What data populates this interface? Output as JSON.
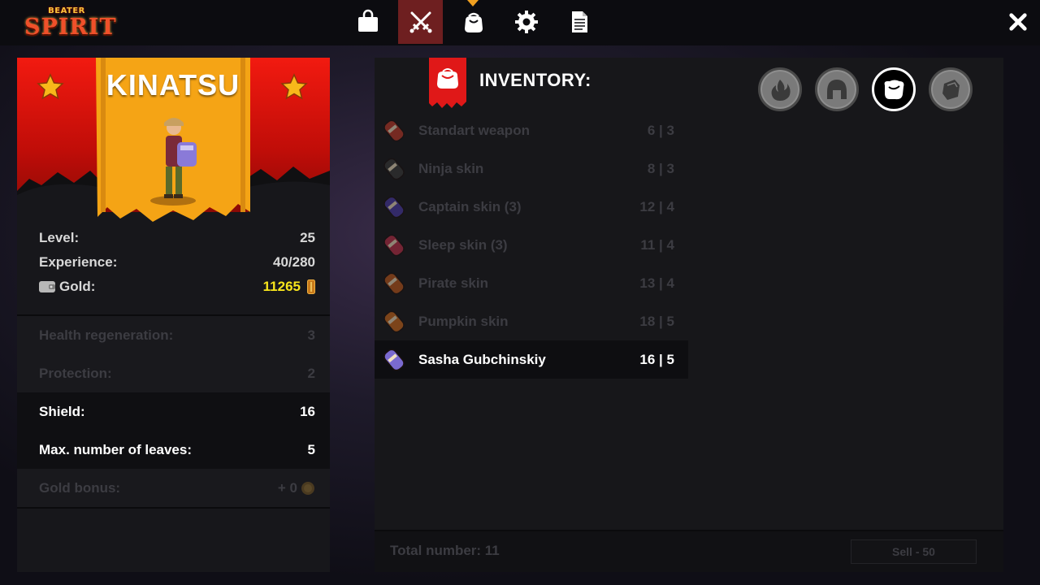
{
  "logo": {
    "top_text": "BEATER",
    "main_text": "SPIRIT"
  },
  "nav": {
    "items": [
      {
        "name": "shop",
        "icon": "shopping-bag-icon",
        "active": false
      },
      {
        "name": "equipment",
        "icon": "crossed-swords-icon",
        "active": true
      },
      {
        "name": "inventory",
        "icon": "bag-icon",
        "active": false,
        "has_marker": true
      },
      {
        "name": "settings",
        "icon": "gear-icon",
        "active": false
      },
      {
        "name": "notes",
        "icon": "document-icon",
        "active": false
      }
    ],
    "close_icon": "close-icon"
  },
  "character": {
    "name": "KINATSU",
    "stats": {
      "level_label": "Level:",
      "level_value": "25",
      "experience_label": "Experience:",
      "experience_value": "40/280",
      "gold_label": "Gold:",
      "gold_value": "11265"
    },
    "attributes": [
      {
        "label": "Health regeneration:",
        "value": "3",
        "active": false
      },
      {
        "label": "Protection:",
        "value": "2",
        "active": false
      },
      {
        "label": "Shield:",
        "value": "16",
        "active": true
      },
      {
        "label": "Max. number of leaves:",
        "value": "5",
        "active": true
      },
      {
        "label": "Gold bonus:",
        "value": "+ 0",
        "active": false
      }
    ]
  },
  "inventory": {
    "title": "INVENTORY:",
    "filters": [
      {
        "icon": "fire-icon",
        "active": false
      },
      {
        "icon": "helmet-icon",
        "active": false
      },
      {
        "icon": "bag-icon",
        "active": true
      },
      {
        "icon": "stone-icon",
        "active": false
      }
    ],
    "items": [
      {
        "name": "Standart weapon",
        "stats": "6 | 3",
        "color": "#c23a2a",
        "selected": false
      },
      {
        "name": "Ninja skin",
        "stats": "8 | 3",
        "color": "#3a3a3a",
        "selected": false
      },
      {
        "name": "Captain skin (3)",
        "stats": "12 | 4",
        "color": "#4b3aa8",
        "selected": false
      },
      {
        "name": "Sleep skin (3)",
        "stats": "11 | 4",
        "color": "#c0304a",
        "selected": false
      },
      {
        "name": "Pirate skin",
        "stats": "13 | 4",
        "color": "#c05a1a",
        "selected": false
      },
      {
        "name": "Pumpkin skin",
        "stats": "18 | 5",
        "color": "#d06a1a",
        "selected": false
      },
      {
        "name": "Sasha Gubchinskiy",
        "stats": "16 | 5",
        "color": "#7a6ad0",
        "selected": true
      }
    ],
    "total_label": "Total number: 11",
    "sell_label": "Sell - 50"
  }
}
